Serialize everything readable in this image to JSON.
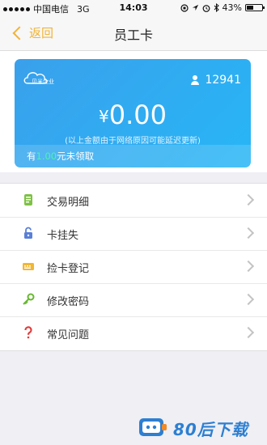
{
  "status_bar": {
    "carrier": "中国电信",
    "network": "3G",
    "time": "14:03",
    "battery": "43%",
    "battery_level": 0.43
  },
  "nav": {
    "back_label": "返回",
    "title": "员工卡"
  },
  "card": {
    "logo_text": "贝米企业",
    "user_id": "12941",
    "currency_symbol": "¥",
    "balance": "0.00",
    "note": "(以上金额由于网络原因可能延迟更新)",
    "unclaimed_prefix": "有",
    "unclaimed_amount": "1.00",
    "unclaimed_suffix": "元未领取",
    "colors": {
      "accent": "#4df2b0",
      "card_start": "#3aa0ec",
      "card_end": "#27b6f6"
    }
  },
  "menu": {
    "items": [
      {
        "label": "交易明细",
        "icon": "transaction-detail-icon"
      },
      {
        "label": "卡挂失",
        "icon": "unlock-icon"
      },
      {
        "label": "捡卡登记",
        "icon": "card-register-icon"
      },
      {
        "label": "修改密码",
        "icon": "key-icon"
      },
      {
        "label": "常见问题",
        "icon": "question-icon"
      }
    ]
  },
  "watermark": {
    "text": "80后下载"
  },
  "theme": {
    "nav_accent": "#f0b339"
  }
}
